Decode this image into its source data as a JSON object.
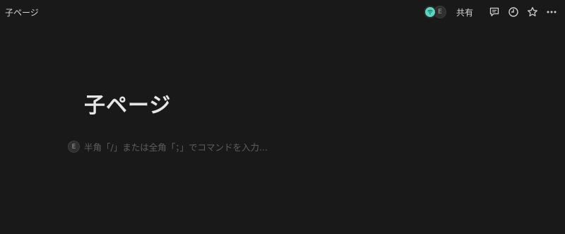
{
  "breadcrumb": {
    "label": "子ページ"
  },
  "header": {
    "avatar_other_initial": "E",
    "share_label": "共有"
  },
  "page": {
    "title": "子ページ",
    "line_avatar_initial": "E",
    "placeholder": "半角「/」または全角「；」でコマンドを入力..."
  },
  "colors": {
    "background": "#191919",
    "teal_avatar": "#5fd4c0"
  },
  "icons": {
    "comments": "speech-bubble",
    "updates": "clock",
    "favorite": "star-outline",
    "more": "three-dots"
  }
}
